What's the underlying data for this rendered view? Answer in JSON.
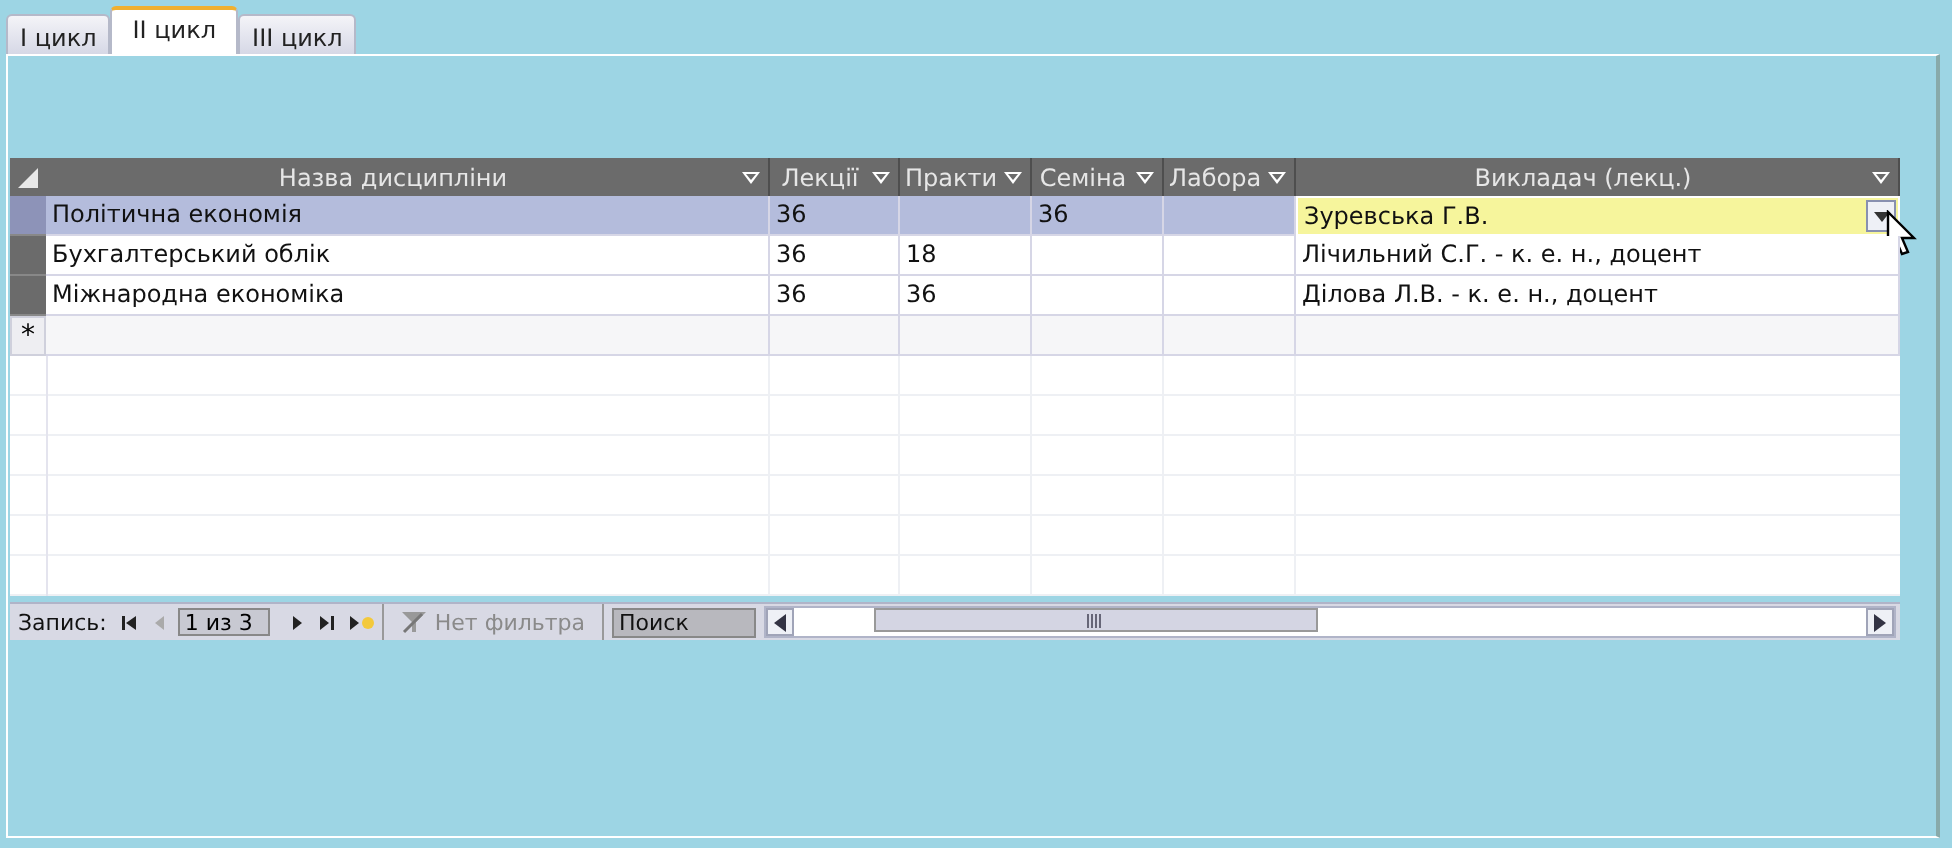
{
  "tabs": [
    {
      "label": "I цикл",
      "selected": false
    },
    {
      "label": "II цикл",
      "selected": true
    },
    {
      "label": "III цикл",
      "selected": false
    }
  ],
  "table": {
    "columns": [
      "Назва дисципліни",
      "Лекції",
      "Практи",
      "Семіна",
      "Лабора",
      "Викладач (лекц.)"
    ],
    "rows": [
      {
        "selected": true,
        "cells": [
          {
            "text": "Політична  економія",
            "active": false
          },
          {
            "text": "36",
            "active": false
          },
          {
            "active": false
          },
          {
            "text": "36",
            "active": false
          },
          {
            "active": false
          },
          {
            "text": "Зуревська Г.В.",
            "active": true
          }
        ]
      },
      {
        "selected": false,
        "cells": [
          {
            "text": "Бухгалтерський облік",
            "active": false
          },
          {
            "text": "36",
            "active": false
          },
          {
            "text": "18",
            "active": false
          },
          {
            "active": false
          },
          {
            "active": false
          },
          {
            "text": "Лічильний С.Г. - к. е. н., доцент",
            "active": false
          }
        ]
      },
      {
        "selected": false,
        "cells": [
          {
            "text": "Міжнародна економіка",
            "active": false
          },
          {
            "text": "36",
            "active": false
          },
          {
            "text": "36",
            "active": false
          },
          {
            "active": false
          },
          {
            "active": false
          },
          {
            "text": "Ділова Л.В. - к. е. н., доцент",
            "active": false
          }
        ]
      }
    ],
    "new_row_marker": "*"
  },
  "navigation": {
    "label": "Запись:",
    "position": "1 из 3",
    "filter": {
      "label": "Нет фильтра",
      "disabled": true
    },
    "search": {
      "placeholder": "Поиск"
    }
  }
}
